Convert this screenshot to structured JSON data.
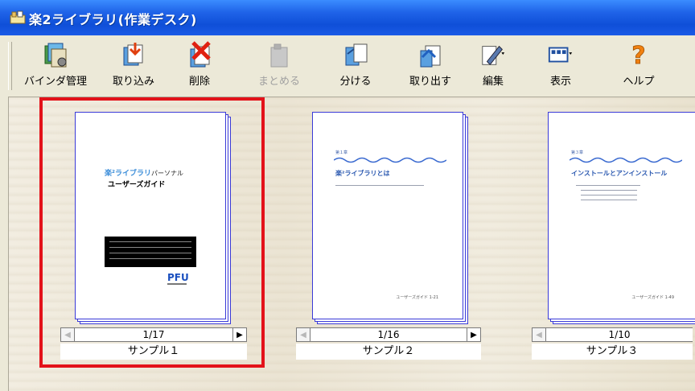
{
  "window": {
    "title": "楽2ライブラリ(作業デスク)"
  },
  "toolbar": {
    "buttons": [
      {
        "label": "バインダ管理",
        "icon": "binder-manage-icon",
        "enabled": true
      },
      {
        "label": "取り込み",
        "icon": "import-icon",
        "enabled": true
      },
      {
        "label": "削除",
        "icon": "delete-icon",
        "enabled": true
      },
      {
        "label": "まとめる",
        "icon": "merge-icon",
        "enabled": false
      },
      {
        "label": "分ける",
        "icon": "split-icon",
        "enabled": true
      },
      {
        "label": "取り出す",
        "icon": "export-icon",
        "enabled": true
      },
      {
        "label": "編集",
        "icon": "edit-icon",
        "enabled": true
      },
      {
        "label": "表示",
        "icon": "view-icon",
        "enabled": true
      },
      {
        "label": "ヘルプ",
        "icon": "help-icon",
        "enabled": true
      }
    ]
  },
  "binders": [
    {
      "name": "サンプル１",
      "counter": "1/17",
      "selected": true,
      "page": {
        "brand": "楽²ライブラリ",
        "brand_suffix": "パーソナル",
        "subtitle": "ユーザーズガイド",
        "logo": "PFU"
      }
    },
    {
      "name": "サンプル２",
      "counter": "1/16",
      "selected": false,
      "page": {
        "chapter": "第１章",
        "heading": "楽²ライブラリとは",
        "footer": "ユーザーズガイド 1-21"
      }
    },
    {
      "name": "サンプル３",
      "counter": "1/10",
      "selected": false,
      "page": {
        "chapter": "第３章",
        "heading": "インストールとアンインストール",
        "footer": "ユーザーズガイド 1-49"
      }
    }
  ],
  "colors": {
    "titlebar": "#1f63e8",
    "toolbar_bg": "#ece9d8",
    "selection": "#e3121a",
    "page_border": "#3a3ad8"
  }
}
